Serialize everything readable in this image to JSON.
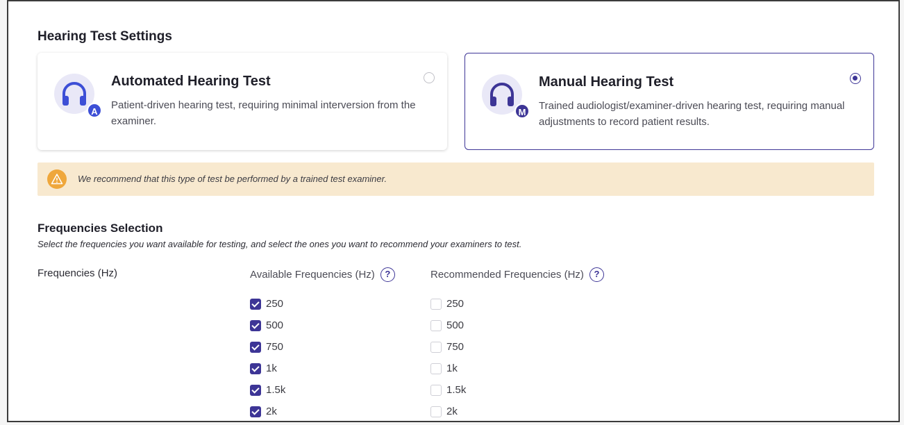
{
  "settings": {
    "title": "Hearing Test Settings",
    "cards": [
      {
        "title": "Automated Hearing Test",
        "description": "Patient-driven hearing test, requiring minimal interversion from the examiner.",
        "badge": "A",
        "selected": false
      },
      {
        "title": "Manual Hearing Test",
        "description": "Trained audiologist/examiner-driven hearing test, requiring manual adjustments to record patient results.",
        "badge": "M",
        "selected": true
      }
    ],
    "warning": {
      "icon": "warning-icon",
      "text": "We recommend that this type of test be performed by a trained test examiner."
    }
  },
  "frequencies": {
    "title": "Frequencies Selection",
    "subtitle": "Select the frequencies you want available for testing, and select the ones you want to recommend your examiners to test.",
    "label": "Frequencies (Hz)",
    "available_header": "Available Frequencies (Hz)",
    "recommended_header": "Recommended Frequencies (Hz)",
    "help_glyph": "?",
    "available": [
      {
        "label": "250",
        "checked": true
      },
      {
        "label": "500",
        "checked": true
      },
      {
        "label": "750",
        "checked": true
      },
      {
        "label": "1k",
        "checked": true
      },
      {
        "label": "1.5k",
        "checked": true
      },
      {
        "label": "2k",
        "checked": true
      }
    ],
    "recommended": [
      {
        "label": "250",
        "checked": false
      },
      {
        "label": "500",
        "checked": false
      },
      {
        "label": "750",
        "checked": false
      },
      {
        "label": "1k",
        "checked": false
      },
      {
        "label": "1.5k",
        "checked": false
      },
      {
        "label": "2k",
        "checked": false
      }
    ]
  },
  "colors": {
    "accent": "#3d3596",
    "warning_bg": "#f8e9cf",
    "warning_icon": "#efa73b"
  }
}
